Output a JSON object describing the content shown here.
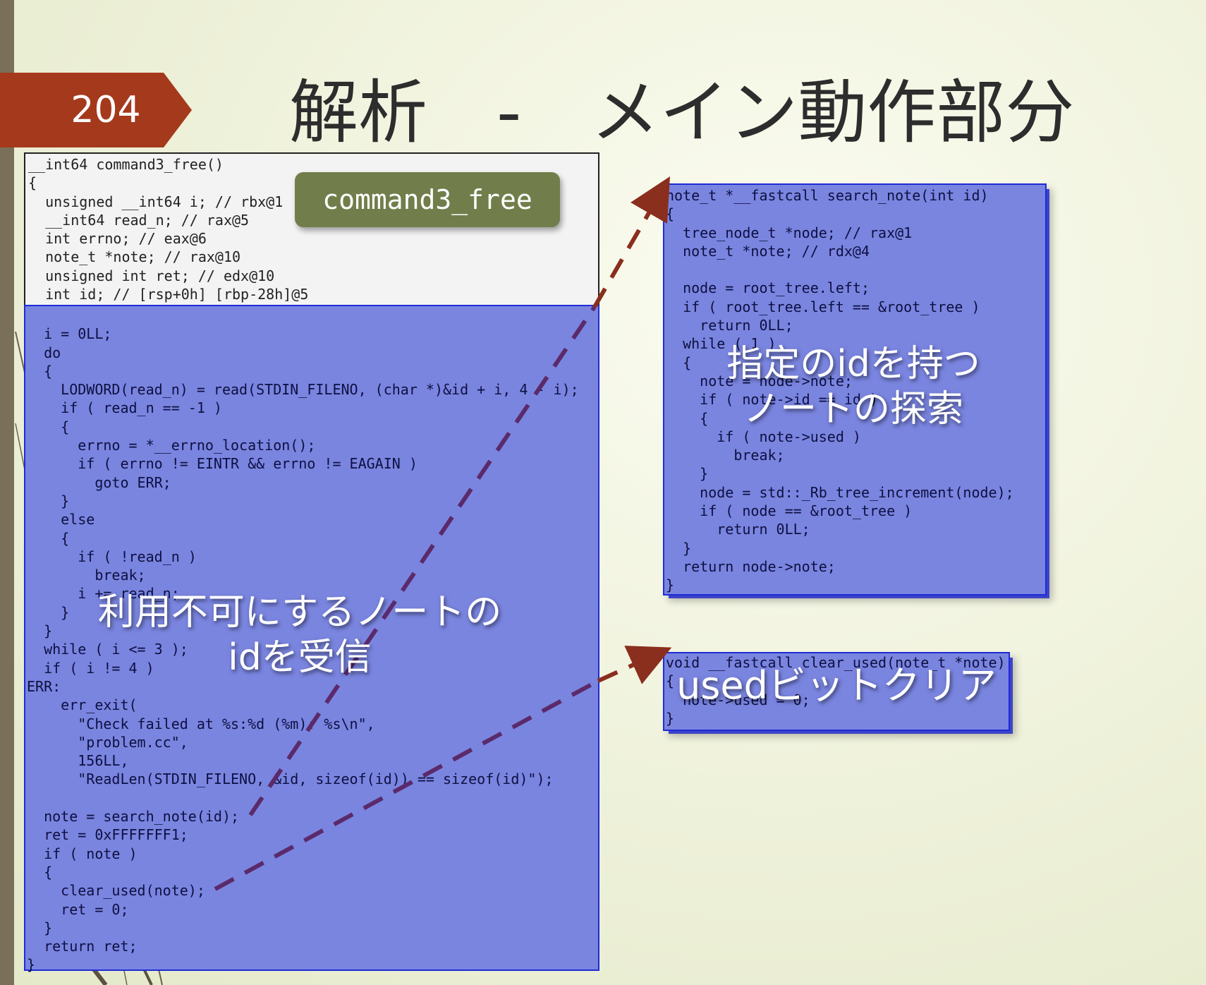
{
  "slide": {
    "number": "204",
    "title": "解析　-　メイン動作部分"
  },
  "badge": {
    "label": "command3_free"
  },
  "main_panel": {
    "header_lines": [
      "__int64 command3_free()",
      "{",
      "  unsigned __int64 i; // rbx@1",
      "  __int64 read_n; // rax@5",
      "  int errno; // eax@6",
      "  note_t *note; // rax@10",
      "  unsigned int ret; // edx@10",
      "  int id; // [rsp+0h] [rbp-28h]@5"
    ],
    "body_lines": [
      "",
      "  i = 0LL;",
      "  do",
      "  {",
      "    LODWORD(read_n) = read(STDIN_FILENO, (char *)&id + i, 4 - i);",
      "    if ( read_n == -1 )",
      "    {",
      "      errno = *__errno_location();",
      "      if ( errno != EINTR && errno != EAGAIN )",
      "        goto ERR;",
      "    }",
      "    else",
      "    {",
      "      if ( !read_n )",
      "        break;",
      "      i += read_n;",
      "    }",
      "  }",
      "  while ( i <= 3 );",
      "  if ( i != 4 )",
      "ERR:",
      "    err_exit(",
      "      \"Check failed at %s:%d (%m): %s\\n\",",
      "      \"problem.cc\",",
      "      156LL,",
      "      \"ReadLen(STDIN_FILENO, &id, sizeof(id)) == sizeof(id)\");",
      "",
      "  note = search_note(id);",
      "  ret = 0xFFFFFFF1;",
      "  if ( note )",
      "  {",
      "    clear_used(note);",
      "    ret = 0;",
      "  }",
      "  return ret;",
      "}"
    ],
    "overlay_text": [
      "利用不可にするノートの",
      "idを受信"
    ]
  },
  "search_panel": {
    "lines": [
      "note_t *__fastcall search_note(int id)",
      "{",
      "  tree_node_t *node; // rax@1",
      "  note_t *note; // rdx@4",
      "",
      "  node = root_tree.left;",
      "  if ( root_tree.left == &root_tree )",
      "    return 0LL;",
      "  while ( 1 )",
      "  {",
      "    note = node->note;",
      "    if ( note->id == id )",
      "    {",
      "      if ( note->used )",
      "        break;",
      "    }",
      "    node = std::_Rb_tree_increment(node);",
      "    if ( node == &root_tree )",
      "      return 0LL;",
      "  }",
      "  return node->note;",
      "}"
    ],
    "overlay_text": [
      "指定のidを持つ",
      "ノートの探索"
    ]
  },
  "clear_panel": {
    "lines": [
      "void __fastcall clear_used(note_t *note)",
      "{",
      "  note->used = 0;",
      "}"
    ],
    "overlay_text": "usedビットクリア"
  },
  "colors": {
    "panel_fill": "#7a85e0",
    "panel_border": "#1f2bd6",
    "badge_fill": "#717e4b",
    "slide_number_fill": "#a5391c",
    "arrow_color": "#8a2e1e"
  }
}
